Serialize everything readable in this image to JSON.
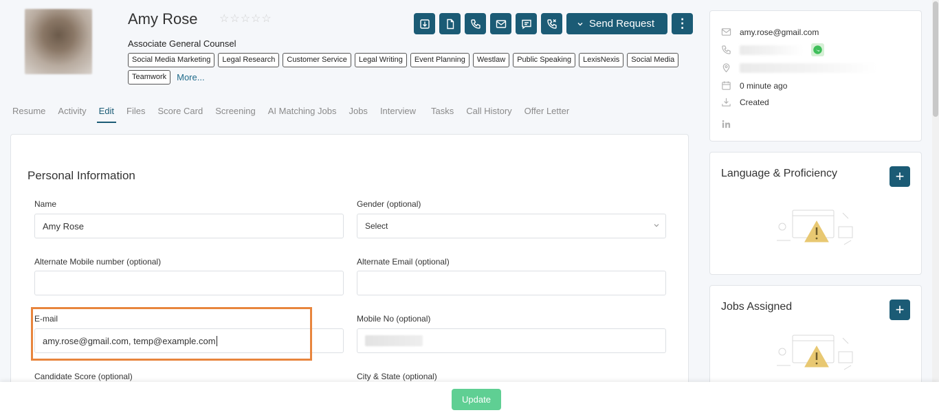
{
  "profile": {
    "name": "Amy Rose",
    "title": "Associate General Counsel",
    "rating": 0,
    "more_label": "More...",
    "tags": [
      "Social Media Marketing",
      "Legal Research",
      "Customer Service",
      "Legal Writing",
      "Event Planning",
      "Westlaw",
      "Public Speaking",
      "LexisNexis",
      "Social Media",
      "Teamwork"
    ]
  },
  "toolbar": {
    "icons": [
      "download-icon",
      "document-icon",
      "phone-icon",
      "mail-icon",
      "message-icon",
      "call-forward-icon"
    ],
    "send_request_label": "Send Request"
  },
  "tabs": [
    "Resume",
    "Activity",
    "Edit",
    "Files",
    "Score Card",
    "Screening",
    "AI Matching Jobs",
    "Jobs",
    "Interview",
    "Tasks",
    "Call History",
    "Offer Letter"
  ],
  "active_tab": "Edit",
  "form": {
    "section_title": "Personal Information",
    "name_label": "Name",
    "name_value": "Amy Rose",
    "gender_label": "Gender (optional)",
    "gender_value": "Select",
    "alt_mobile_label": "Alternate Mobile number (optional)",
    "alt_mobile_value": "",
    "alt_email_label": "Alternate Email (optional)",
    "alt_email_value": "",
    "email_label": "E-mail",
    "email_value": "amy.rose@gmail.com, temp@example.com",
    "mobile_label": "Mobile No (optional)",
    "candidate_score_label": "Candidate Score (optional)",
    "city_state_label": "City & State (optional)"
  },
  "contact": {
    "email": "amy.rose@gmail.com",
    "time": "0 minute ago",
    "created": "Created"
  },
  "panels": {
    "language_title": "Language & Proficiency",
    "jobs_title": "Jobs Assigned"
  },
  "footer": {
    "update_label": "Update"
  },
  "colors": {
    "primary": "#1b5b75",
    "highlight": "#e8853d",
    "update": "#5fcf93"
  }
}
